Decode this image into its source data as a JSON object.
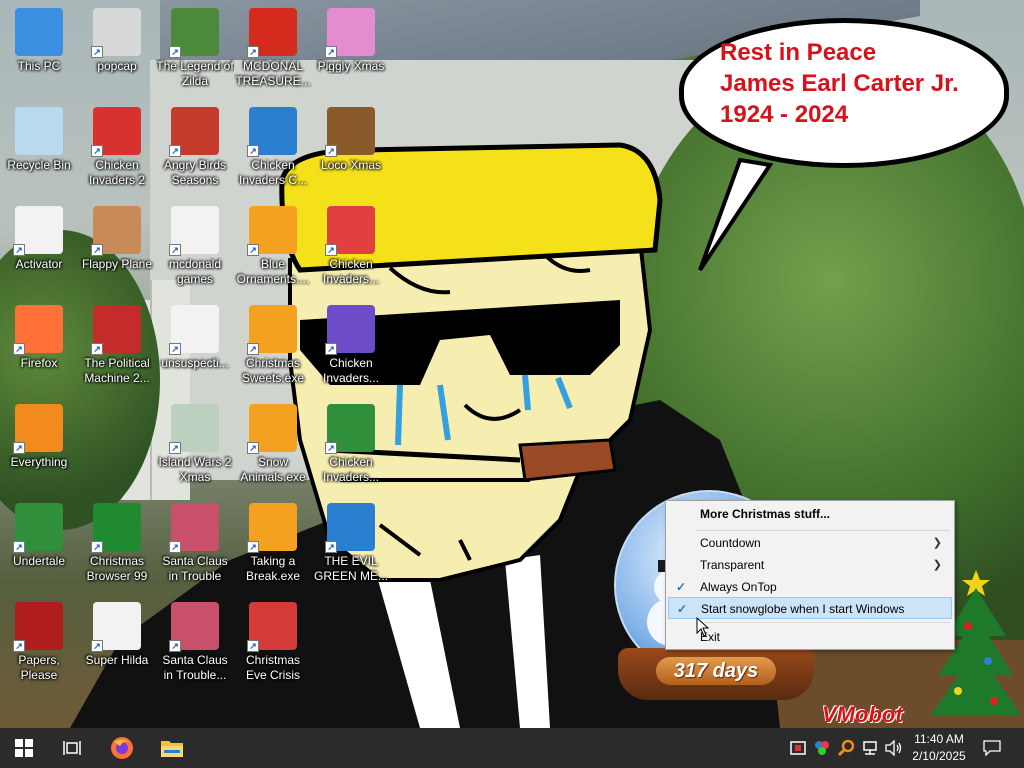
{
  "desktop": {
    "icons": [
      {
        "label": "This PC",
        "icon": "computer-icon",
        "color": "#3a8fe0"
      },
      {
        "label": "popcap",
        "icon": "folder-icon",
        "color": "#d8d8d8"
      },
      {
        "label": "The Legend of Zilda",
        "icon": "game-icon",
        "color": "#4a8a3a"
      },
      {
        "label": "MCDONAL TREASURE...",
        "icon": "mcdonalds-icon",
        "color": "#d52b1e"
      },
      {
        "label": "Piggly Xmas",
        "icon": "game-icon",
        "color": "#e58bd0"
      },
      {
        "label": "Recycle Bin",
        "icon": "recycle-bin-icon",
        "color": "#b9d9ef"
      },
      {
        "label": "Chicken Invaders 2",
        "icon": "game-icon",
        "color": "#d93030"
      },
      {
        "label": "Angry Birds Seasons",
        "icon": "game-icon",
        "color": "#c43b2b"
      },
      {
        "label": "Chicken Invaders C...",
        "icon": "game-icon",
        "color": "#2b7fd1"
      },
      {
        "label": "Loco Xmas",
        "icon": "game-icon",
        "color": "#8b5a2b"
      },
      {
        "label": "Activator",
        "icon": "file-icon",
        "color": "#f2f2f2"
      },
      {
        "label": "Flappy Plane",
        "icon": "game-icon",
        "color": "#c98a5a"
      },
      {
        "label": "mcdonald games",
        "icon": "file-icon",
        "color": "#f2f2f2"
      },
      {
        "label": "Blue Ornaments....",
        "icon": "game-icon",
        "color": "#f4a020"
      },
      {
        "label": "Chicken Invaders...",
        "icon": "game-icon",
        "color": "#e04040"
      },
      {
        "label": "Firefox",
        "icon": "firefox-icon",
        "color": "#ff7139"
      },
      {
        "label": "The Political Machine 2...",
        "icon": "game-icon",
        "color": "#c42b2b"
      },
      {
        "label": "unsuspecti...",
        "icon": "file-icon",
        "color": "#f2f2f2"
      },
      {
        "label": "Christmas Sweets.exe",
        "icon": "game-icon",
        "color": "#f4a020"
      },
      {
        "label": "Chicken Invaders...",
        "icon": "game-icon",
        "color": "#6d4cc9"
      },
      {
        "label": "Everything",
        "icon": "search-icon",
        "color": "#f28a1e"
      },
      {
        "label": "Island Wars 2 Xmas",
        "icon": "game-icon",
        "color": "#bcd0c0"
      },
      {
        "label": "Snow Animals.exe",
        "icon": "game-icon",
        "color": "#f4a020"
      },
      {
        "label": "Chicken Invaders...",
        "icon": "game-icon",
        "color": "#2f8f3a"
      },
      {
        "label": "Undertale",
        "icon": "game-icon",
        "color": "#2f8f3a"
      },
      {
        "label": "Christmas Browser 99",
        "icon": "tree-icon",
        "color": "#1f8a2f"
      },
      {
        "label": "Santa Claus in Trouble",
        "icon": "game-icon",
        "color": "#c9506a"
      },
      {
        "label": "Taking a Break.exe",
        "icon": "game-icon",
        "color": "#f4a020"
      },
      {
        "label": "THE EVIL GREEN ME...",
        "icon": "messenger-icon",
        "color": "#2b7fd1"
      },
      {
        "label": "Papers, Please",
        "icon": "game-icon",
        "color": "#b01d1d"
      },
      {
        "label": "Super Hilda",
        "icon": "game-icon",
        "color": "#f2f2f2"
      },
      {
        "label": "Santa Claus in Trouble... A...",
        "icon": "game-icon",
        "color": "#c9506a"
      },
      {
        "label": "Christmas Eve Crisis",
        "icon": "game-icon",
        "color": "#d43a3a"
      }
    ]
  },
  "bubble": {
    "line1": "Rest in Peace",
    "line2": "James Earl Carter Jr.",
    "line3": "1924 - 2024",
    "color": "#d6121a"
  },
  "snowglobe": {
    "days": "317 days",
    "watermark": "VMobot"
  },
  "context_menu": {
    "items": [
      {
        "label": "More Christmas stuff...",
        "bold": true
      },
      {
        "label": "Countdown",
        "submenu": true
      },
      {
        "label": "Transparent",
        "submenu": true
      },
      {
        "label": "Always OnTop",
        "checked": true
      },
      {
        "label": "Start snowglobe when I start Windows",
        "checked": true,
        "highlighted": true
      },
      {
        "label": "Exit"
      }
    ]
  },
  "taskbar": {
    "start": "windows-start-icon",
    "task_view": "task-view-icon",
    "pinned": [
      "firefox-icon",
      "file-explorer-icon"
    ],
    "tray_icons": [
      "security-icon",
      "app-tray-icon",
      "search-tray-icon",
      "network-icon",
      "volume-icon"
    ],
    "time": "11:40 AM",
    "date": "2/10/2025",
    "notification": "notification-icon"
  }
}
